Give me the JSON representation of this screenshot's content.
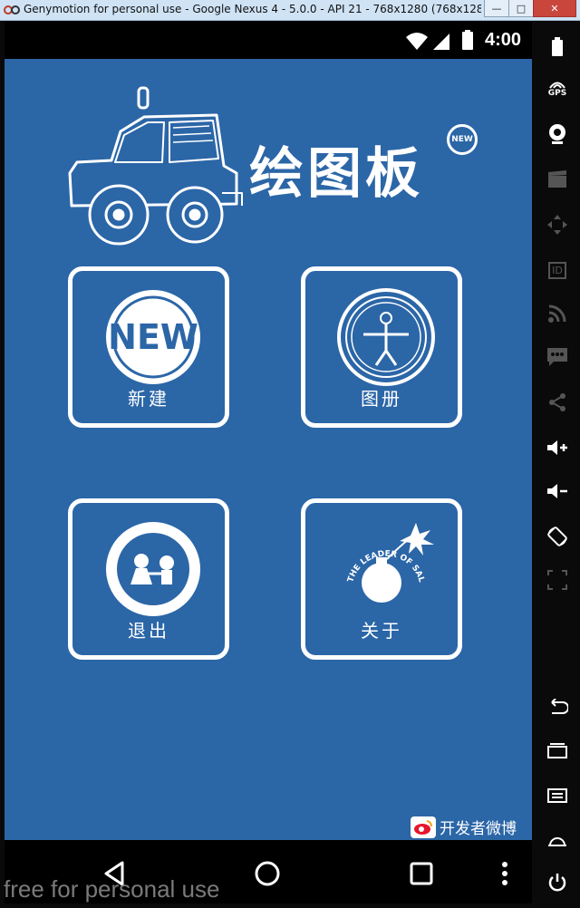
{
  "window": {
    "title": "Genymotion for personal use - Google Nexus 4 - 5.0.0 - API 21 - 768x1280 (768x1280,...",
    "minimize": "—",
    "maximize": "□",
    "close": "✕"
  },
  "statusbar": {
    "time": "4:00"
  },
  "app": {
    "logo_text": "绘图板",
    "logo_badge": "NEW",
    "tiles": [
      {
        "label": "新建",
        "icon_text": "NEW"
      },
      {
        "label": "图册"
      },
      {
        "label": "退出"
      },
      {
        "label": "关于",
        "icon_text": "THE LEADER OF SALES"
      }
    ],
    "weibo_label": "开发者微博"
  },
  "sidebar": {
    "gps_label": "GPS",
    "id_label": "ID"
  },
  "watermark": "free for personal use",
  "colors": {
    "background": "#2b66a7",
    "foreground": "#ffffff"
  },
  "icons": {
    "status": [
      "wifi-icon",
      "signal-icon",
      "battery-icon"
    ],
    "nav": [
      "back-icon",
      "home-icon",
      "recents-icon",
      "menu-dots-icon"
    ],
    "sidebar": [
      "battery-icon",
      "gps-icon",
      "webcam-icon",
      "video-icon",
      "dpad-icon",
      "id-icon",
      "rss-icon",
      "sms-icon",
      "share-icon",
      "volume-up-icon",
      "volume-down-icon",
      "rotate-icon",
      "resize-icon",
      "back-icon",
      "recents-icon",
      "menu-icon",
      "home-icon",
      "power-icon"
    ]
  }
}
